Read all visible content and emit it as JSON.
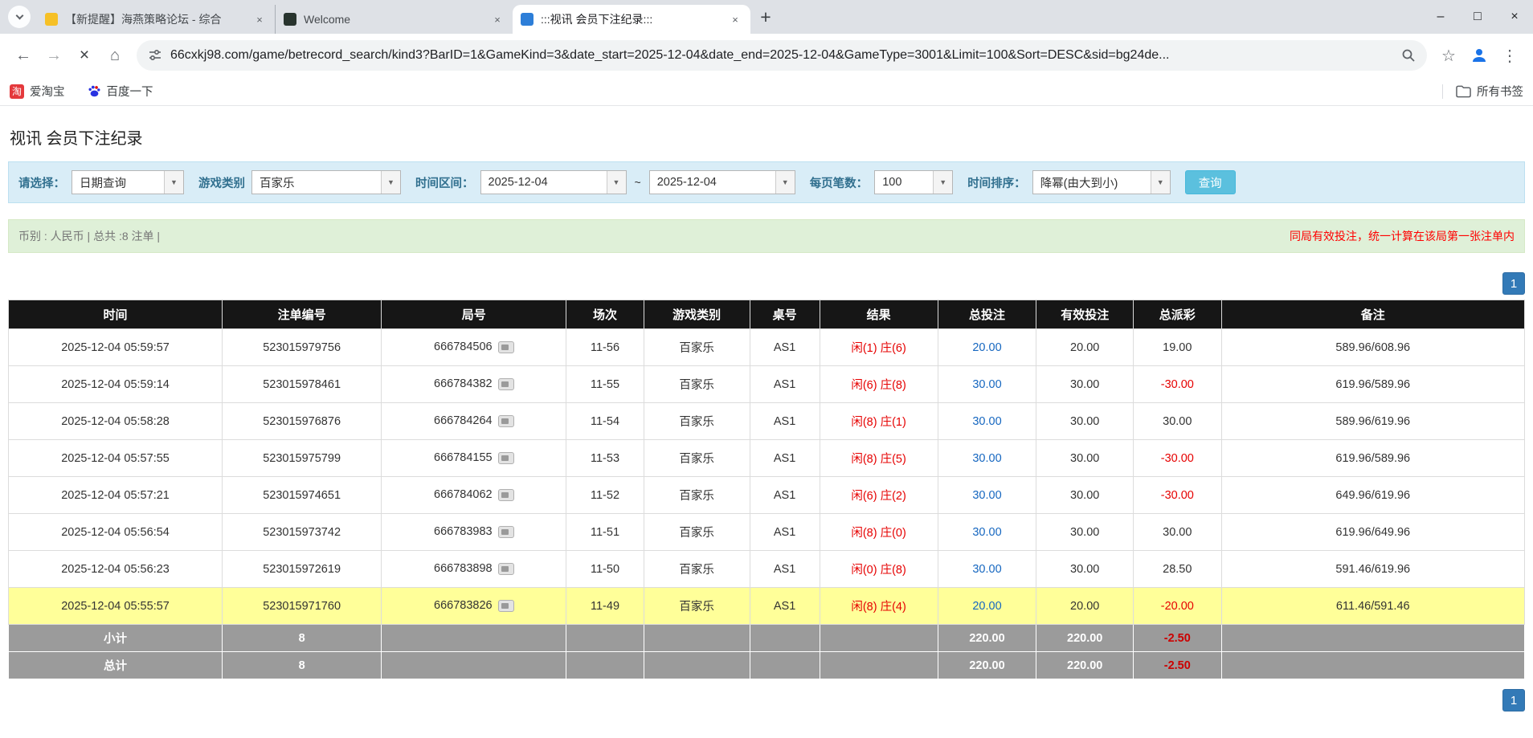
{
  "browser": {
    "tabs": [
      {
        "title": "【新提醒】海燕策略论坛 - 综合",
        "favicon_color": "#f6c026",
        "active": false
      },
      {
        "title": "Welcome",
        "favicon_color": "#28342e",
        "active": false
      },
      {
        "title": ":::视讯 会员下注纪录:::",
        "favicon_color": "#2d7ed8",
        "active": true
      }
    ],
    "url": "66cxkj98.com/game/betrecord_search/kind3?BarID=1&GameKind=3&date_start=2025-12-04&date_end=2025-12-04&GameType=3001&Limit=100&Sort=DESC&sid=bg24de...",
    "bookmarks": [
      {
        "label": "爱淘宝",
        "icon_text": "淘"
      },
      {
        "label": "百度一下"
      }
    ],
    "all_bookmarks_label": "所有书签"
  },
  "page": {
    "title": "视讯 会员下注纪录",
    "filters": {
      "select": {
        "label": "请选择：",
        "value": "日期查询"
      },
      "game": {
        "label": "游戏类别",
        "value": "百家乐"
      },
      "range": {
        "label": "时间区间：",
        "start": "2025-12-04",
        "separator": "~",
        "end": "2025-12-04"
      },
      "per_page": {
        "label": "每页笔数：",
        "value": "100"
      },
      "sort": {
        "label": "时间排序：",
        "value": "降幂(由大到小)"
      },
      "search_button": "查询"
    },
    "summary": {
      "left": "币别 : 人民币 | 总共 :8 注单 |",
      "right": "同局有效投注，统一计算在该局第一张注单内"
    },
    "pagination": {
      "current": "1"
    }
  },
  "table": {
    "headers": [
      "时间",
      "注单编号",
      "局号",
      "场次",
      "游戏类别",
      "桌号",
      "结果",
      "总投注",
      "有效投注",
      "总派彩",
      "备注"
    ],
    "rows": [
      {
        "time": "2025-12-04 05:59:57",
        "bet_id": "523015979756",
        "round": "666784506",
        "session": "11-56",
        "game": "百家乐",
        "table_no": "AS1",
        "result": {
          "player": "闲(1)",
          "banker": "庄(6)"
        },
        "total_bet": "20.00",
        "valid_bet": "20.00",
        "payout": "19.00",
        "note": "589.96/608.96",
        "highlight": false
      },
      {
        "time": "2025-12-04 05:59:14",
        "bet_id": "523015978461",
        "round": "666784382",
        "session": "11-55",
        "game": "百家乐",
        "table_no": "AS1",
        "result": {
          "player": "闲(6)",
          "banker": "庄(8)"
        },
        "total_bet": "30.00",
        "valid_bet": "30.00",
        "payout": "-30.00",
        "note": "619.96/589.96",
        "highlight": false
      },
      {
        "time": "2025-12-04 05:58:28",
        "bet_id": "523015976876",
        "round": "666784264",
        "session": "11-54",
        "game": "百家乐",
        "table_no": "AS1",
        "result": {
          "player": "闲(8)",
          "banker": "庄(1)"
        },
        "total_bet": "30.00",
        "valid_bet": "30.00",
        "payout": "30.00",
        "note": "589.96/619.96",
        "highlight": false
      },
      {
        "time": "2025-12-04 05:57:55",
        "bet_id": "523015975799",
        "round": "666784155",
        "session": "11-53",
        "game": "百家乐",
        "table_no": "AS1",
        "result": {
          "player": "闲(8)",
          "banker": "庄(5)"
        },
        "total_bet": "30.00",
        "valid_bet": "30.00",
        "payout": "-30.00",
        "note": "619.96/589.96",
        "highlight": false
      },
      {
        "time": "2025-12-04 05:57:21",
        "bet_id": "523015974651",
        "round": "666784062",
        "session": "11-52",
        "game": "百家乐",
        "table_no": "AS1",
        "result": {
          "player": "闲(6)",
          "banker": "庄(2)"
        },
        "total_bet": "30.00",
        "valid_bet": "30.00",
        "payout": "-30.00",
        "note": "649.96/619.96",
        "highlight": false
      },
      {
        "time": "2025-12-04 05:56:54",
        "bet_id": "523015973742",
        "round": "666783983",
        "session": "11-51",
        "game": "百家乐",
        "table_no": "AS1",
        "result": {
          "player": "闲(8)",
          "banker": "庄(0)"
        },
        "total_bet": "30.00",
        "valid_bet": "30.00",
        "payout": "30.00",
        "note": "619.96/649.96",
        "highlight": false
      },
      {
        "time": "2025-12-04 05:56:23",
        "bet_id": "523015972619",
        "round": "666783898",
        "session": "11-50",
        "game": "百家乐",
        "table_no": "AS1",
        "result": {
          "player": "闲(0)",
          "banker": "庄(8)"
        },
        "total_bet": "30.00",
        "valid_bet": "30.00",
        "payout": "28.50",
        "note": "591.46/619.96",
        "highlight": false
      },
      {
        "time": "2025-12-04 05:55:57",
        "bet_id": "523015971760",
        "round": "666783826",
        "session": "11-49",
        "game": "百家乐",
        "table_no": "AS1",
        "result": {
          "player": "闲(8)",
          "banker": "庄(4)"
        },
        "total_bet": "20.00",
        "valid_bet": "20.00",
        "payout": "-20.00",
        "note": "611.46/591.46",
        "highlight": true
      }
    ],
    "subtotal": {
      "label": "小计",
      "count": "8",
      "total_bet": "220.00",
      "valid_bet": "220.00",
      "payout": "-2.50"
    },
    "total": {
      "label": "总计",
      "count": "8",
      "total_bet": "220.00",
      "valid_bet": "220.00",
      "payout": "-2.50"
    }
  },
  "colors": {
    "link_blue": "#1667c0",
    "negative_red": "#e60000",
    "result_red": "#e60000",
    "highlight_yellow": "#ffff99",
    "table_header_bg": "#161616",
    "footer_bg": "#9b9b9b",
    "filter_bg": "#d9edf7",
    "summary_bg": "#dff0d8",
    "search_button_bg": "#5bc0de",
    "pagination_bg": "#337ab7"
  }
}
